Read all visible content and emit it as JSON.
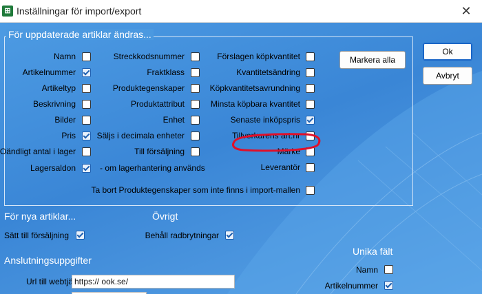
{
  "window": {
    "title": "Inställningar för import/export",
    "app_icon_glyph": "⊞",
    "close_glyph": "✕"
  },
  "group_updated": {
    "title": "För uppdaterade artiklar ändras...",
    "col1": [
      {
        "label": "Namn",
        "checked": false
      },
      {
        "label": "Artikelnummer",
        "checked": true
      },
      {
        "label": "Artikeltyp",
        "checked": false
      },
      {
        "label": "Beskrivning",
        "checked": false
      },
      {
        "label": "Bilder",
        "checked": false
      },
      {
        "label": "Pris",
        "checked": true
      },
      {
        "label": "Oändligt antal i lager",
        "checked": false
      },
      {
        "label": "Lagersaldon",
        "checked": true
      }
    ],
    "lagersaldon_suffix": "- om lagerhantering används",
    "col2": [
      {
        "label": "Streckkodsnummer",
        "checked": false
      },
      {
        "label": "Fraktklass",
        "checked": false
      },
      {
        "label": "Produktegenskaper",
        "checked": false
      },
      {
        "label": "Produktattribut",
        "checked": false
      },
      {
        "label": "Enhet",
        "checked": false
      },
      {
        "label": "Säljs i decimala enheter",
        "checked": false
      },
      {
        "label": "Till försäljning",
        "checked": false
      }
    ],
    "col3": [
      {
        "label": "Förslagen köpkvantitet",
        "checked": false
      },
      {
        "label": "Kvantitetsändring",
        "checked": false
      },
      {
        "label": "Köpkvantitetsavrundning",
        "checked": false
      },
      {
        "label": "Minsta köpbara kvantitet",
        "checked": false
      },
      {
        "label": "Senaste inköpspris",
        "checked": true
      },
      {
        "label": "Tillverkarens art.nr",
        "checked": false
      },
      {
        "label": "Märke",
        "checked": false
      },
      {
        "label": "Leverantör",
        "checked": false
      }
    ],
    "remove_props": {
      "label": "Ta bort Produktegenskaper som inte finns i import-mallen",
      "checked": false
    },
    "mark_all_button": "Markera alla"
  },
  "buttons": {
    "ok": "Ok",
    "cancel": "Avbryt"
  },
  "group_new": {
    "title": "För nya artiklar...",
    "items": [
      {
        "label": "Sätt till försäljning",
        "checked": true
      }
    ]
  },
  "group_other": {
    "title": "Övrigt",
    "items": [
      {
        "label": "Behåll radbrytningar",
        "checked": true
      }
    ]
  },
  "group_connection": {
    "title": "Anslutningsuppgifter",
    "url_label": "Url till webtjänst",
    "url_value": "https://                    ook.se/"
  },
  "group_unique": {
    "title": "Unika fält",
    "items": [
      {
        "label": "Namn",
        "checked": false
      },
      {
        "label": "Artikelnummer",
        "checked": true
      }
    ]
  },
  "colors": {
    "background": "#3f8bdb",
    "annotation": "#e0102a",
    "checkbox_check": "#1d5fb0"
  }
}
